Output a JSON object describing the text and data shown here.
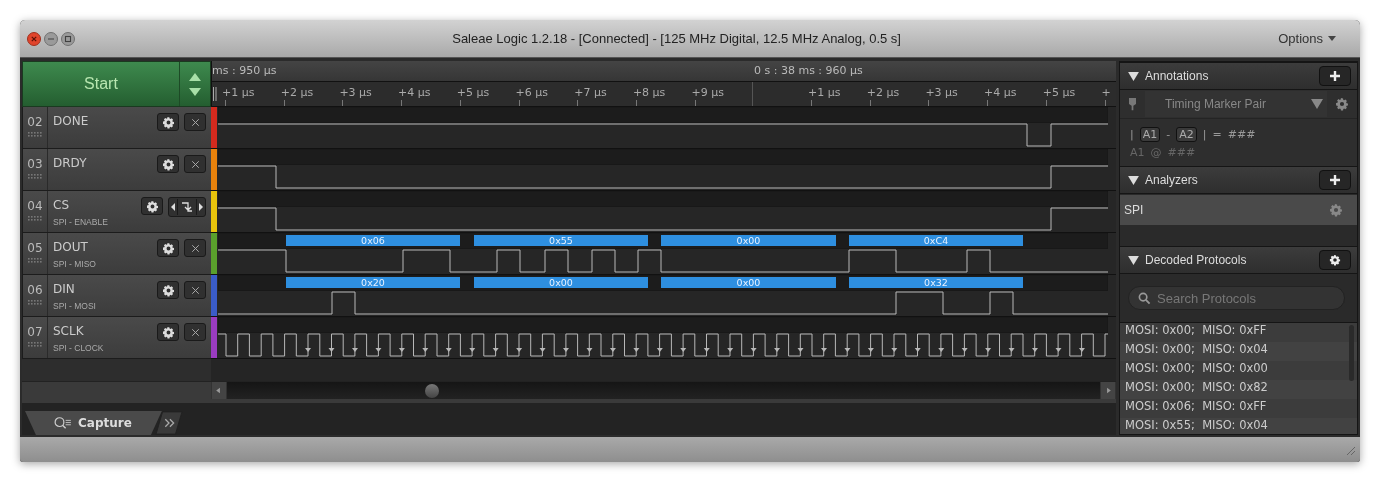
{
  "window": {
    "title": "Saleae Logic 1.2.18 - [Connected] - [125 MHz Digital, 12.5 MHz Analog, 0.5 s]",
    "options_label": "Options"
  },
  "start_button": {
    "label": "Start"
  },
  "ruler": {
    "time_labels": [
      "ms : 950 µs",
      "0 s : 38 ms : 960 µs"
    ],
    "ticks": [
      "+1 µs",
      "+2 µs",
      "+3 µs",
      "+4 µs",
      "+5 µs",
      "+6 µs",
      "+7 µs",
      "+8 µs",
      "+9 µs",
      "+1 µs",
      "+2 µs",
      "+3 µs",
      "+4 µs",
      "+5 µs",
      "+"
    ]
  },
  "channels": [
    {
      "number": "02",
      "name": "DONE",
      "kind": "removable",
      "color": "#d42a1e"
    },
    {
      "number": "03",
      "name": "DRDY",
      "kind": "removable",
      "color": "#e8820c"
    },
    {
      "number": "04",
      "name": "CS",
      "subtitle": "SPI - ENABLE",
      "kind": "trigger",
      "color": "#e8c40c"
    },
    {
      "number": "05",
      "name": "DOUT",
      "subtitle": "SPI - MISO",
      "kind": "removable",
      "color": "#5aa02c",
      "decoded": [
        "0x06",
        "0x55",
        "0x00",
        "0xC4"
      ]
    },
    {
      "number": "06",
      "name": "DIN",
      "subtitle": "SPI - MOSI",
      "kind": "removable",
      "color": "#3a5cc8",
      "decoded": [
        "0x20",
        "0x00",
        "0x00",
        "0x32"
      ]
    },
    {
      "number": "07",
      "name": "SCLK",
      "subtitle": "SPI - CLOCK",
      "kind": "removable",
      "color": "#9a3cc0"
    }
  ],
  "bottom_tabs": [
    {
      "label": "Capture",
      "selected": true
    }
  ],
  "annotations": {
    "title": "Annotations",
    "marker_type": "Timing Marker Pair",
    "formula": [
      "|",
      "A1",
      "-",
      "A2",
      "|",
      "=",
      "###"
    ],
    "marker_line": [
      "A1",
      "@",
      "###"
    ]
  },
  "analyzers": {
    "title": "Analyzers",
    "items": [
      "SPI"
    ]
  },
  "decoded_protocols": {
    "title": "Decoded Protocols",
    "search": {
      "placeholder": "Search Protocols"
    },
    "rows": [
      "MOSI: 0x00;  MISO: 0xFF",
      "MOSI: 0x00;  MISO: 0x04",
      "MOSI: 0x00;  MISO: 0x00",
      "MOSI: 0x00;  MISO: 0x82",
      "MOSI: 0x06;  MISO: 0xFF",
      "MOSI: 0x55;  MISO: 0x04"
    ]
  }
}
